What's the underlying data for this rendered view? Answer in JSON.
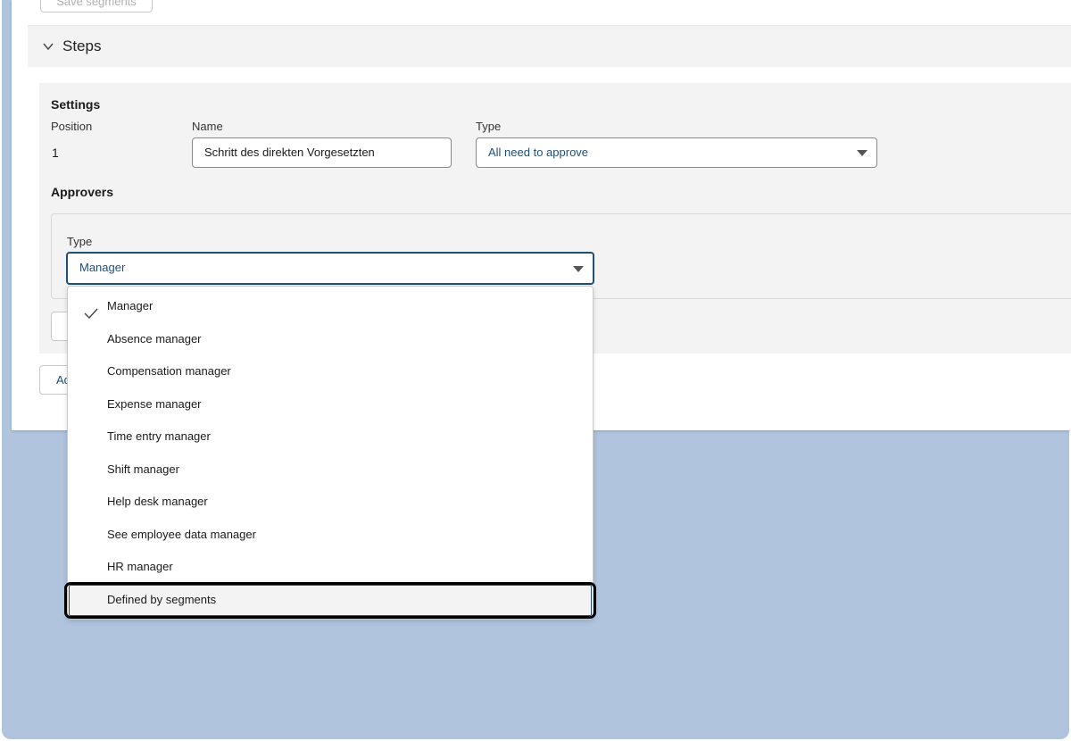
{
  "top_button": {
    "label": "Save segments"
  },
  "steps": {
    "title": "Steps"
  },
  "settings": {
    "title": "Settings",
    "position_label": "Position",
    "position_value": "1",
    "name_label": "Name",
    "name_value": "Schritt des direkten Vorgesetzten",
    "type_label": "Type",
    "type_value": "All need to approve"
  },
  "approvers": {
    "title": "Approvers",
    "type_label": "Type",
    "type_value": "Manager",
    "add_button_label": "Add"
  },
  "dropdown": {
    "options": [
      {
        "label": "Manager",
        "selected": true
      },
      {
        "label": "Absence manager"
      },
      {
        "label": "Compensation manager"
      },
      {
        "label": "Expense manager"
      },
      {
        "label": "Time entry manager"
      },
      {
        "label": "Shift manager"
      },
      {
        "label": "Help desk manager"
      },
      {
        "label": "See employee data manager"
      },
      {
        "label": "HR manager"
      },
      {
        "label": "Defined by segments",
        "focused": true
      }
    ]
  },
  "colors": {
    "backdrop": "#b0c4de",
    "accent": "#1f4e79",
    "panel": "#f3f3f3"
  }
}
